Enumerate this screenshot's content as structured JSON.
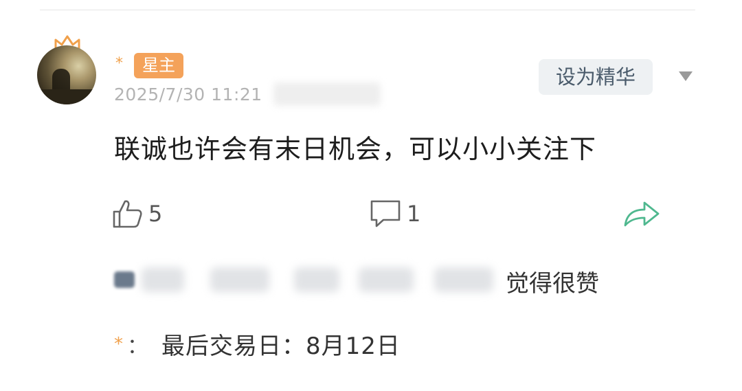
{
  "post": {
    "author_name": "*",
    "badge": "星主",
    "timestamp": "2025/7/30 11:21",
    "content": "联诚也许会有末日机会，可以小小关注下",
    "set_featured_label": "设为精华",
    "like_count": "5",
    "comment_count": "1",
    "liked_by_suffix": "觉得很赞"
  },
  "reply": {
    "author": "*",
    "colon": "：",
    "text": "最后交易日：8月12日"
  },
  "icons": {
    "like": "thumbs-up-icon",
    "comment": "comment-icon",
    "share": "share-icon",
    "more": "chevron-down-icon",
    "crown": "crown-icon"
  },
  "colors": {
    "badge": "#f4a25a",
    "accent_star": "#f0a04b",
    "share": "#4fb88f",
    "muted": "#b3b3b3"
  }
}
